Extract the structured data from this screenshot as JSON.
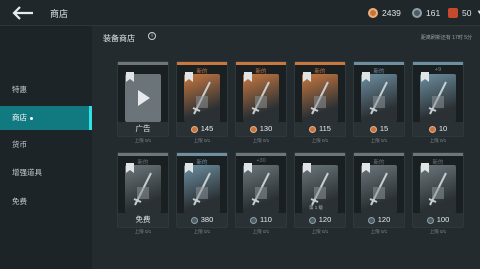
{
  "header": {
    "title": "商店",
    "currencies": [
      {
        "icon": "copper-coin-icon",
        "value": "2439",
        "color": "#c6753b"
      },
      {
        "icon": "silver-coin-icon",
        "value": "161",
        "color": "#6f8591"
      },
      {
        "icon": "gem-icon",
        "value": "50",
        "color": "#c54a2e"
      }
    ]
  },
  "sidebar": {
    "items": [
      {
        "label": "特惠"
      },
      {
        "label": "商店"
      },
      {
        "label": "货币"
      },
      {
        "label": "增强道具"
      },
      {
        "label": "免费"
      }
    ]
  },
  "main": {
    "section_title": "装备商店",
    "refresh_text": "距离刷新还有   17时 5分",
    "cards_row1": [
      {
        "badge": "",
        "price": "广告",
        "sub": "上限 0/1",
        "frame": "#6d777b",
        "currency": "ad",
        "image": "play-icon"
      },
      {
        "badge": "新的",
        "price": "145",
        "sub": "上限 0/1",
        "frame": "#c97840",
        "currency": "cu",
        "image": "sword-icon"
      },
      {
        "badge": "新的",
        "price": "130",
        "sub": "上限 0/1",
        "frame": "#c97840",
        "currency": "cu",
        "image": "armor-icon"
      },
      {
        "badge": "新的",
        "price": "115",
        "sub": "上限 0/1",
        "frame": "#c97840",
        "currency": "cu",
        "image": "helmet-icon"
      },
      {
        "badge": "新的",
        "price": "15",
        "sub": "上限 0/1",
        "frame": "#6d8fa0",
        "currency": "cu",
        "image": "glove-icon"
      },
      {
        "badge": "+9",
        "price": "10",
        "sub": "上限 0/1",
        "frame": "#6d8fa0",
        "currency": "cu",
        "image": "helmet-icon"
      }
    ],
    "cards_row2": [
      {
        "badge": "新的",
        "price": "免费",
        "sub": "上限 0/1",
        "frame": "#6d777b",
        "currency": "ad",
        "image": "swords-icon"
      },
      {
        "badge": "新的",
        "price": "380",
        "sub": "上限 0/1",
        "frame": "#6d8fa0",
        "currency": "ic",
        "image": "armor-icon"
      },
      {
        "badge": "+30",
        "price": "110",
        "sub": "上限 0/1",
        "frame": "#6d777b",
        "currency": "ic",
        "image": "armor-icon"
      },
      {
        "badge": "",
        "price": "120",
        "sub": "上限 0/1",
        "frame": "#6d777b",
        "currency": "ic",
        "image": "spear-icon",
        "caption": "第 1 级"
      },
      {
        "badge": "新的",
        "price": "120",
        "sub": "上限 0/1",
        "frame": "#6d777b",
        "currency": "ic",
        "image": "swords-icon"
      },
      {
        "badge": "新的",
        "price": "100",
        "sub": "上限 0/1",
        "frame": "#6d777b",
        "currency": "ic",
        "image": "helmet-icon"
      }
    ]
  }
}
